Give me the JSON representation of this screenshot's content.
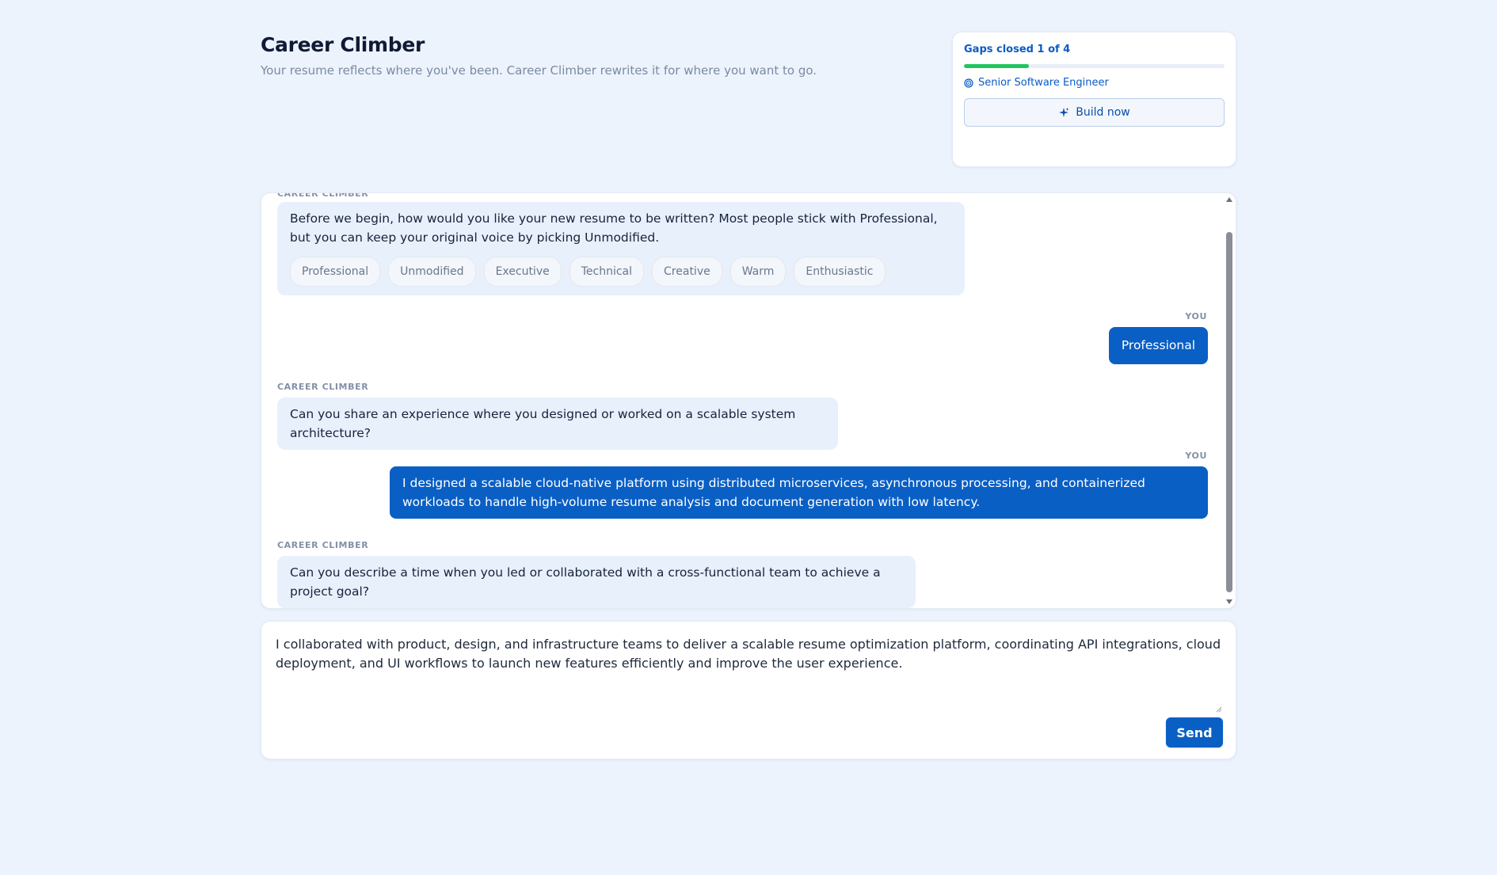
{
  "header": {
    "title": "Career Climber",
    "subtitle": "Your resume reflects where you've been. Career Climber rewrites it for where you want to go."
  },
  "progress": {
    "label": "Gaps closed 1 of 4",
    "closed": 1,
    "total": 4,
    "fill_fraction": 0.25,
    "fill_color": "#22c55e",
    "target_role": "Senior Software Engineer",
    "target_icon": "target-icon",
    "build_label": "Build now",
    "build_icon": "sparkle-icon"
  },
  "chat": {
    "bot_sender": "CAREER CLIMBER",
    "user_sender": "YOU",
    "messages": [
      {
        "role": "bot",
        "text": "Before we begin, how would you like your new resume to be written? Most people stick with Professional, but you can keep your original voice by picking Unmodified.",
        "options": [
          "Professional",
          "Unmodified",
          "Executive",
          "Technical",
          "Creative",
          "Warm",
          "Enthusiastic"
        ]
      },
      {
        "role": "user",
        "text": "Professional"
      },
      {
        "role": "bot",
        "text": "Can you share an experience where you designed or worked on a scalable system architecture?"
      },
      {
        "role": "user",
        "text": "I designed a scalable cloud-native platform using distributed microservices, asynchronous processing, and containerized workloads to handle high-volume resume analysis and document generation with low latency."
      },
      {
        "role": "bot",
        "text": "Can you describe a time when you led or collaborated with a cross-functional team to achieve a project goal?"
      }
    ]
  },
  "composer": {
    "value": "I collaborated with product, design, and infrastructure teams to deliver a scalable resume optimization platform, coordinating API integrations, cloud deployment, and UI workflows to launch new features efficiently and improve the user experience.",
    "send_label": "Send"
  },
  "colors": {
    "background": "#edf3fc",
    "accent": "#0a5fc4",
    "bot_bubble": "#e8f0fc",
    "progress": "#22c55e"
  }
}
